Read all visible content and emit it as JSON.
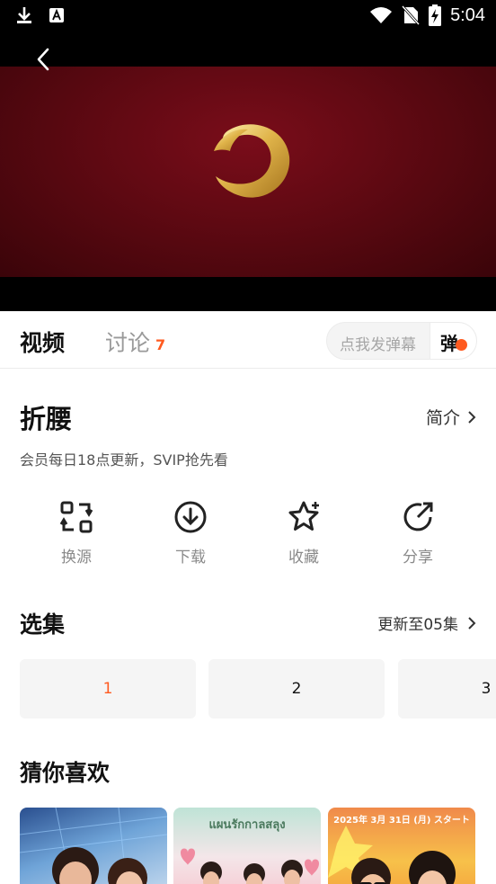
{
  "status_bar": {
    "time": "5:04",
    "icons": [
      "download-icon",
      "app-a-icon",
      "wifi-icon",
      "no-sim-icon",
      "battery-charging-icon"
    ]
  },
  "player": {
    "back_icon": "chevron-left-icon",
    "logo": "gold-crescent-logo",
    "frame_color": "#6b0a16"
  },
  "tabs": {
    "video": "视频",
    "discuss": "讨论",
    "discuss_count": "7"
  },
  "danmaku": {
    "placeholder": "点我发弹幕",
    "toggle_label": "弹"
  },
  "show": {
    "title": "折腰",
    "intro_label": "简介",
    "subtitle": "会员每日18点更新，SVIP抢先看"
  },
  "actions": [
    {
      "label": "换源",
      "icon": "switch-source-icon"
    },
    {
      "label": "下载",
      "icon": "download-icon"
    },
    {
      "label": "收藏",
      "icon": "star-icon"
    },
    {
      "label": "分享",
      "icon": "share-icon"
    }
  ],
  "episodes": {
    "title": "选集",
    "update_label": "更新至05集",
    "items": [
      "1",
      "2",
      "3"
    ],
    "active_index": 0
  },
  "recommend": {
    "title": "猜你喜欢",
    "posters": [
      {
        "name": "poster-1",
        "text": ""
      },
      {
        "name": "poster-2",
        "text": "แผนรักกาลสลุง"
      },
      {
        "name": "poster-3",
        "text": "2025年 3月 31日 (月) スタート"
      }
    ]
  },
  "colors": {
    "accent": "#ff5a1f",
    "muted": "#8a8a8a"
  }
}
